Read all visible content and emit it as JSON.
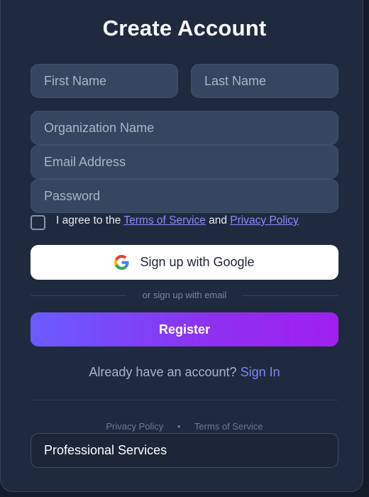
{
  "form": {
    "title": "Create Account",
    "first_name_placeholder": "First Name",
    "last_name_placeholder": "Last Name",
    "organization_placeholder": "Organization Name",
    "email_placeholder": "Email Address",
    "password_placeholder": "Password",
    "terms_prefix": "I agree to the",
    "terms_link": "Terms of Service",
    "terms_and": "and",
    "privacy_link": "Privacy Policy",
    "google_button_label": "Sign up with Google",
    "divider_text": "or sign up with email",
    "register_button_label": "Register",
    "signin_prompt": "Already have an account?",
    "signin_link": "Sign In"
  },
  "footer": {
    "privacy_link": "Privacy Policy",
    "separator": "•",
    "terms_link": "Terms of Service",
    "industry_select_value": "Professional Services"
  },
  "colors": {
    "card_background": "#1f2a3e",
    "input_background": "#364660",
    "link_accent": "#8a8dff",
    "register_gradient_start": "#6a5cff",
    "register_gradient_end": "#a020f0"
  },
  "icons": {
    "google": "google-logo-icon"
  }
}
